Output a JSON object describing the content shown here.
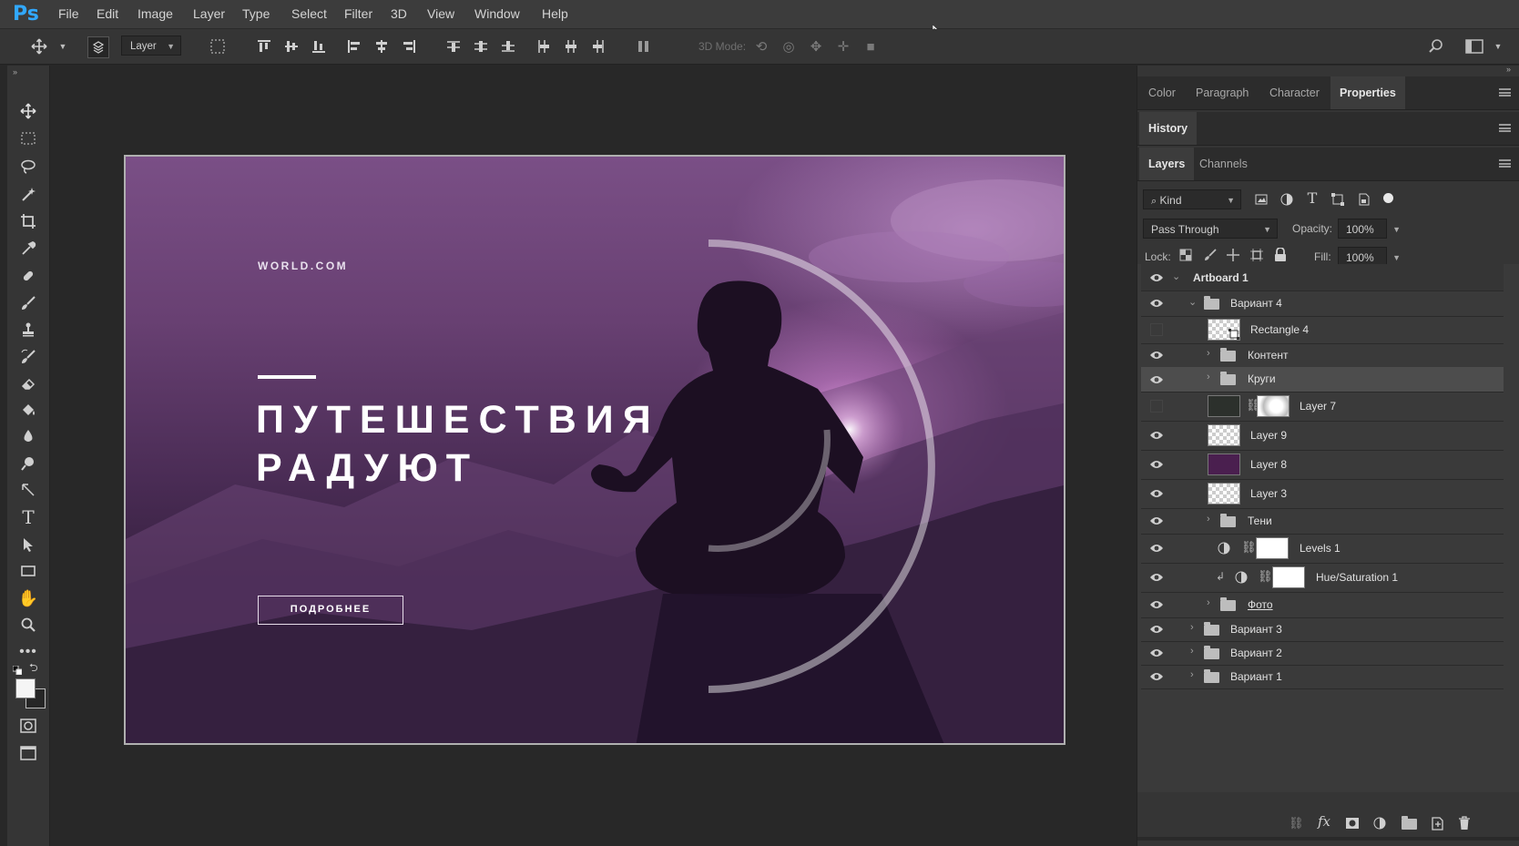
{
  "app": {
    "logo": "Ps"
  },
  "menu": [
    "File",
    "Edit",
    "Image",
    "Layer",
    "Type",
    "Select",
    "Filter",
    "3D",
    "View",
    "Window",
    "Help"
  ],
  "options_bar": {
    "auto_select_value": "Layer",
    "mode_3d_label": "3D Mode:"
  },
  "artboard": {
    "site": "WORLD.COM",
    "title_line1": "ПУТЕШЕСТВИЯ",
    "title_line2": "РАДУЮТ",
    "button_label": "ПОДРОБНЕЕ"
  },
  "panels": {
    "top_tabs": [
      "Color",
      "Paragraph",
      "Character",
      "Properties"
    ],
    "active_top_tab": "Properties",
    "history_tab": "History",
    "layer_tabs": [
      "Layers",
      "Channels"
    ],
    "filter_kind": "Kind",
    "blend_mode": "Pass Through",
    "opacity_label": "Opacity:",
    "opacity_value": "100%",
    "lock_label": "Lock:",
    "fill_label": "Fill:",
    "fill_value": "100%"
  },
  "layers": [
    {
      "name": "Artboard 1",
      "visible": true,
      "kind": "artboard",
      "expanded": true
    },
    {
      "name": "Вариант 4",
      "visible": true,
      "kind": "group",
      "expanded": true
    },
    {
      "name": "Rectangle 4",
      "visible": false,
      "kind": "shape"
    },
    {
      "name": "Контент",
      "visible": true,
      "kind": "group",
      "expanded": false
    },
    {
      "name": "Круги",
      "visible": true,
      "kind": "group",
      "expanded": false,
      "selected": true
    },
    {
      "name": "Layer 7",
      "visible": false,
      "kind": "masked"
    },
    {
      "name": "Layer 9",
      "visible": true,
      "kind": "pixel"
    },
    {
      "name": "Layer 8",
      "visible": true,
      "kind": "fill",
      "color": "#4a1f4f"
    },
    {
      "name": "Layer 3",
      "visible": true,
      "kind": "pixel"
    },
    {
      "name": "Тени",
      "visible": true,
      "kind": "group",
      "expanded": false
    },
    {
      "name": "Levels 1",
      "visible": true,
      "kind": "adjustment"
    },
    {
      "name": "Hue/Saturation 1",
      "visible": true,
      "kind": "adjustment-clipped"
    },
    {
      "name": "Фото",
      "visible": true,
      "kind": "group",
      "expanded": false
    },
    {
      "name": "Вариант 3",
      "visible": true,
      "kind": "group",
      "expanded": false
    },
    {
      "name": "Вариант 2",
      "visible": true,
      "kind": "group",
      "expanded": false
    },
    {
      "name": "Вариант 1",
      "visible": true,
      "kind": "group",
      "expanded": false
    }
  ],
  "colors": {
    "accent": "#31a8ff",
    "panel": "#353535",
    "canvas_bg": "#282828"
  }
}
